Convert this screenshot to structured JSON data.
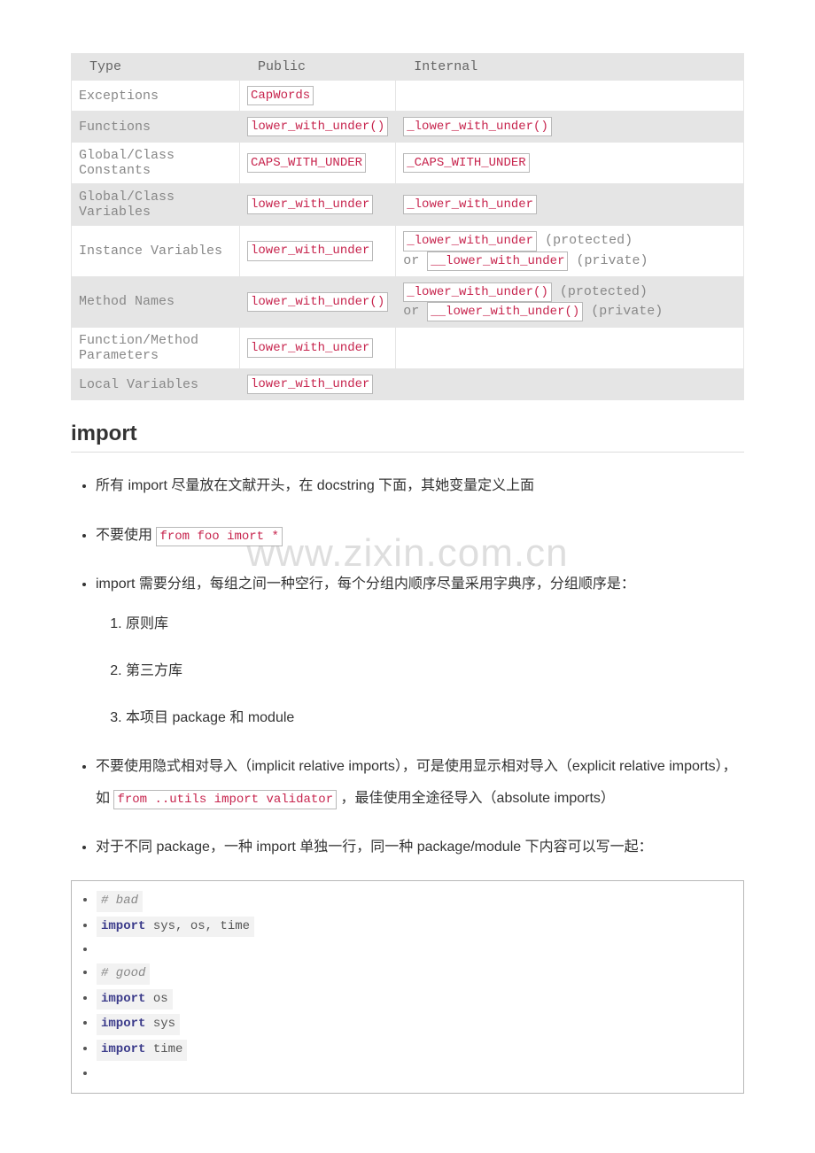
{
  "watermark": "www.zixin.com.cn",
  "table": {
    "headers": [
      "Type",
      "Public",
      "Internal"
    ],
    "rows": [
      {
        "shade": false,
        "type": "Exceptions",
        "public_codes": [
          "CapWords"
        ],
        "internal": {
          "items": []
        }
      },
      {
        "shade": true,
        "type": "Functions",
        "public_codes": [
          "lower_with_under()"
        ],
        "internal": {
          "items": [
            {
              "code": "_lower_with_under()"
            }
          ]
        }
      },
      {
        "shade": false,
        "type": "Global/Class Constants",
        "public_codes": [
          "CAPS_WITH_UNDER"
        ],
        "internal": {
          "items": [
            {
              "code": "_CAPS_WITH_UNDER"
            }
          ]
        }
      },
      {
        "shade": true,
        "type": "Global/Class Variables",
        "public_codes": [
          "lower_with_under"
        ],
        "internal": {
          "items": [
            {
              "code": "_lower_with_under"
            }
          ]
        }
      },
      {
        "shade": false,
        "type": "Instance Variables",
        "public_codes": [
          "lower_with_under"
        ],
        "internal": {
          "items": [
            {
              "code": "_lower_with_under",
              "suffix": " (protected)"
            },
            {
              "prefix": "or ",
              "code": "__lower_with_under",
              "suffix": " (private)"
            }
          ]
        }
      },
      {
        "shade": true,
        "type": "Method Names",
        "public_codes": [
          "lower_with_under()"
        ],
        "internal": {
          "items": [
            {
              "code": "_lower_with_under()",
              "suffix": " (protected)"
            },
            {
              "prefix": "or ",
              "code": "__lower_with_under()",
              "suffix": " (private)"
            }
          ]
        }
      },
      {
        "shade": false,
        "type": "Function/Method Parameters",
        "public_codes": [
          "lower_with_under"
        ],
        "internal": {
          "items": []
        }
      },
      {
        "shade": true,
        "type": "Local Variables",
        "public_codes": [
          "lower_with_under"
        ],
        "internal": {
          "items": []
        }
      }
    ]
  },
  "section_title": "import",
  "bullets": {
    "b1": "所有 import 尽量放在文献开头，在 docstring 下面，其她变量定义上面",
    "b2_pre": "不要使用 ",
    "b2_code": "from foo imort *",
    "b3": "import 需要分组，每组之间一种空行，每个分组内顺序尽量采用字典序，分组顺序是：",
    "b3_sub": [
      "原则库",
      "第三方库",
      "本项目 package 和 module"
    ],
    "b4_pre": "不要使用隐式相对导入（implicit relative imports），可是使用显示相对导入（explicit relative imports），如 ",
    "b4_code": "from ..utils import validator",
    "b4_post": " ，最佳使用全途径导入（absolute imports）",
    "b5": "对于不同 package，一种 import 单独一行，同一种 package/module 下内容可以写一起："
  },
  "codeblock": [
    {
      "type": "comment",
      "text": "# bad"
    },
    {
      "type": "code",
      "kw": "import",
      "rest": " sys, os, time"
    },
    {
      "type": "blank"
    },
    {
      "type": "comment",
      "text": "# good"
    },
    {
      "type": "code",
      "kw": "import",
      "rest": " os"
    },
    {
      "type": "code",
      "kw": "import",
      "rest": " sys"
    },
    {
      "type": "code",
      "kw": "import",
      "rest": " time"
    },
    {
      "type": "blank"
    }
  ]
}
